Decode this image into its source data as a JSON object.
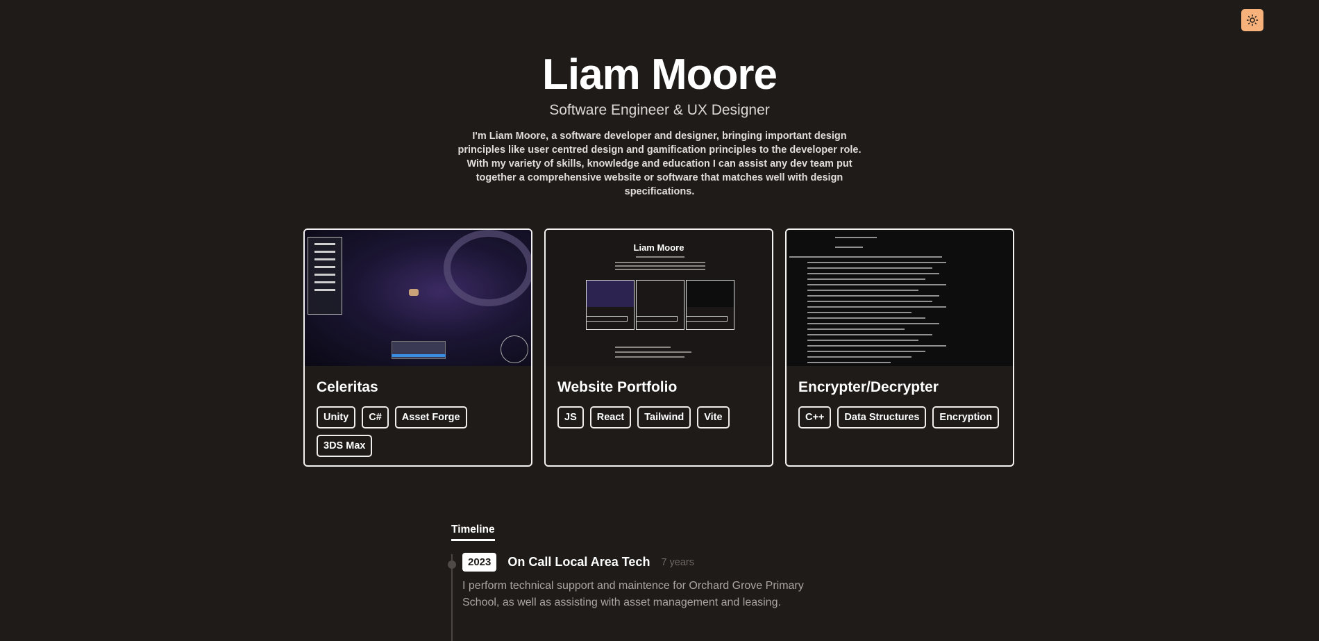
{
  "theme_toggle": {
    "icon": "sun-icon",
    "color": "#f6b27a"
  },
  "hero": {
    "name": "Liam Moore",
    "subtitle": "Software Engineer & UX Designer",
    "bio": "I'm Liam Moore, a software developer and designer, bringing important design principles like user centred design and gamification principles to the developer role. With my variety of skills, knowledge and education I can assist any dev team put together a comprehensive website or software that matches well with design specifications."
  },
  "projects": [
    {
      "title": "Celeritas",
      "tags": [
        "Unity",
        "C#",
        "Asset Forge",
        "3DS Max"
      ]
    },
    {
      "title": "Website Portfolio",
      "tags": [
        "JS",
        "React",
        "Tailwind",
        "Vite"
      ],
      "thumb_title": "Liam Moore"
    },
    {
      "title": "Encrypter/Decrypter",
      "tags": [
        "C++",
        "Data Structures",
        "Encryption"
      ]
    }
  ],
  "timeline": {
    "heading": "Timeline",
    "entries": [
      {
        "year": "2023",
        "title": "On Call Local Area Tech",
        "duration": "7 years",
        "description": "I perform technical support and maintence for Orchard Grove Primary School, as well as assisting with asset management and leasing."
      }
    ]
  },
  "colors": {
    "background": "#1f1b18",
    "accent": "#f6b27a",
    "muted_text": "#aaa5a0"
  }
}
